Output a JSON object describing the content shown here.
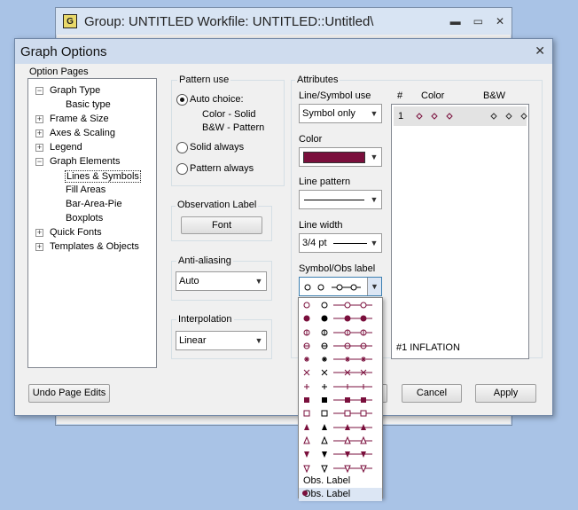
{
  "background_window": {
    "icon_letter": "G",
    "title": "Group: UNTITLED   Workfile: UNTITLED::Untitled\\"
  },
  "dialog": {
    "title": "Graph Options",
    "close_glyph": "✕"
  },
  "option_pages": {
    "label": "Option Pages",
    "items": [
      {
        "label": "Graph Type",
        "expander": "−"
      },
      {
        "label": "Basic type"
      },
      {
        "label": "Frame & Size",
        "expander": "+"
      },
      {
        "label": "Axes & Scaling",
        "expander": "+"
      },
      {
        "label": "Legend",
        "expander": "+"
      },
      {
        "label": "Graph Elements",
        "expander": "−"
      },
      {
        "label": "Lines & Symbols",
        "selected": true
      },
      {
        "label": "Fill Areas"
      },
      {
        "label": "Bar-Area-Pie"
      },
      {
        "label": "Boxplots"
      },
      {
        "label": "Quick Fonts",
        "expander": "+"
      },
      {
        "label": "Templates & Objects",
        "expander": "+"
      }
    ]
  },
  "pattern_use": {
    "label": "Pattern use",
    "auto_choice": "Auto choice:",
    "auto_line1": "Color - Solid",
    "auto_line2": "B&W - Pattern",
    "solid_always": "Solid always",
    "pattern_always": "Pattern always",
    "selected": "auto_choice"
  },
  "observation_label": {
    "label": "Observation Label",
    "font_button": "Font"
  },
  "anti_aliasing": {
    "label": "Anti-aliasing",
    "value": "Auto"
  },
  "interpolation": {
    "label": "Interpolation",
    "value": "Linear"
  },
  "attributes": {
    "label": "Attributes",
    "line_symbol_use": {
      "label": "Line/Symbol use",
      "value": "Symbol only"
    },
    "color": {
      "label": "Color",
      "value": "#7a0f3c"
    },
    "line_pattern": {
      "label": "Line pattern"
    },
    "line_width": {
      "label": "Line width",
      "value": "3/4 pt"
    },
    "symbol_obs_label": {
      "label": "Symbol/Obs label"
    }
  },
  "series_list": {
    "col_num": "#",
    "col_color": "Color",
    "col_bw": "B&W",
    "rows": [
      {
        "num": "1"
      }
    ],
    "footer": "#1 INFLATION"
  },
  "buttons": {
    "undo": "Undo Page Edits",
    "cancel": "Cancel",
    "apply": "Apply"
  },
  "symbol_dropdown": {
    "obs_label": "Obs. Label",
    "obs_label_marked": "Obs. Label"
  },
  "colors": {
    "accent": "#7a0f3c",
    "window_bg": "#f0f0f0",
    "desktop": "#a9c3e6"
  }
}
